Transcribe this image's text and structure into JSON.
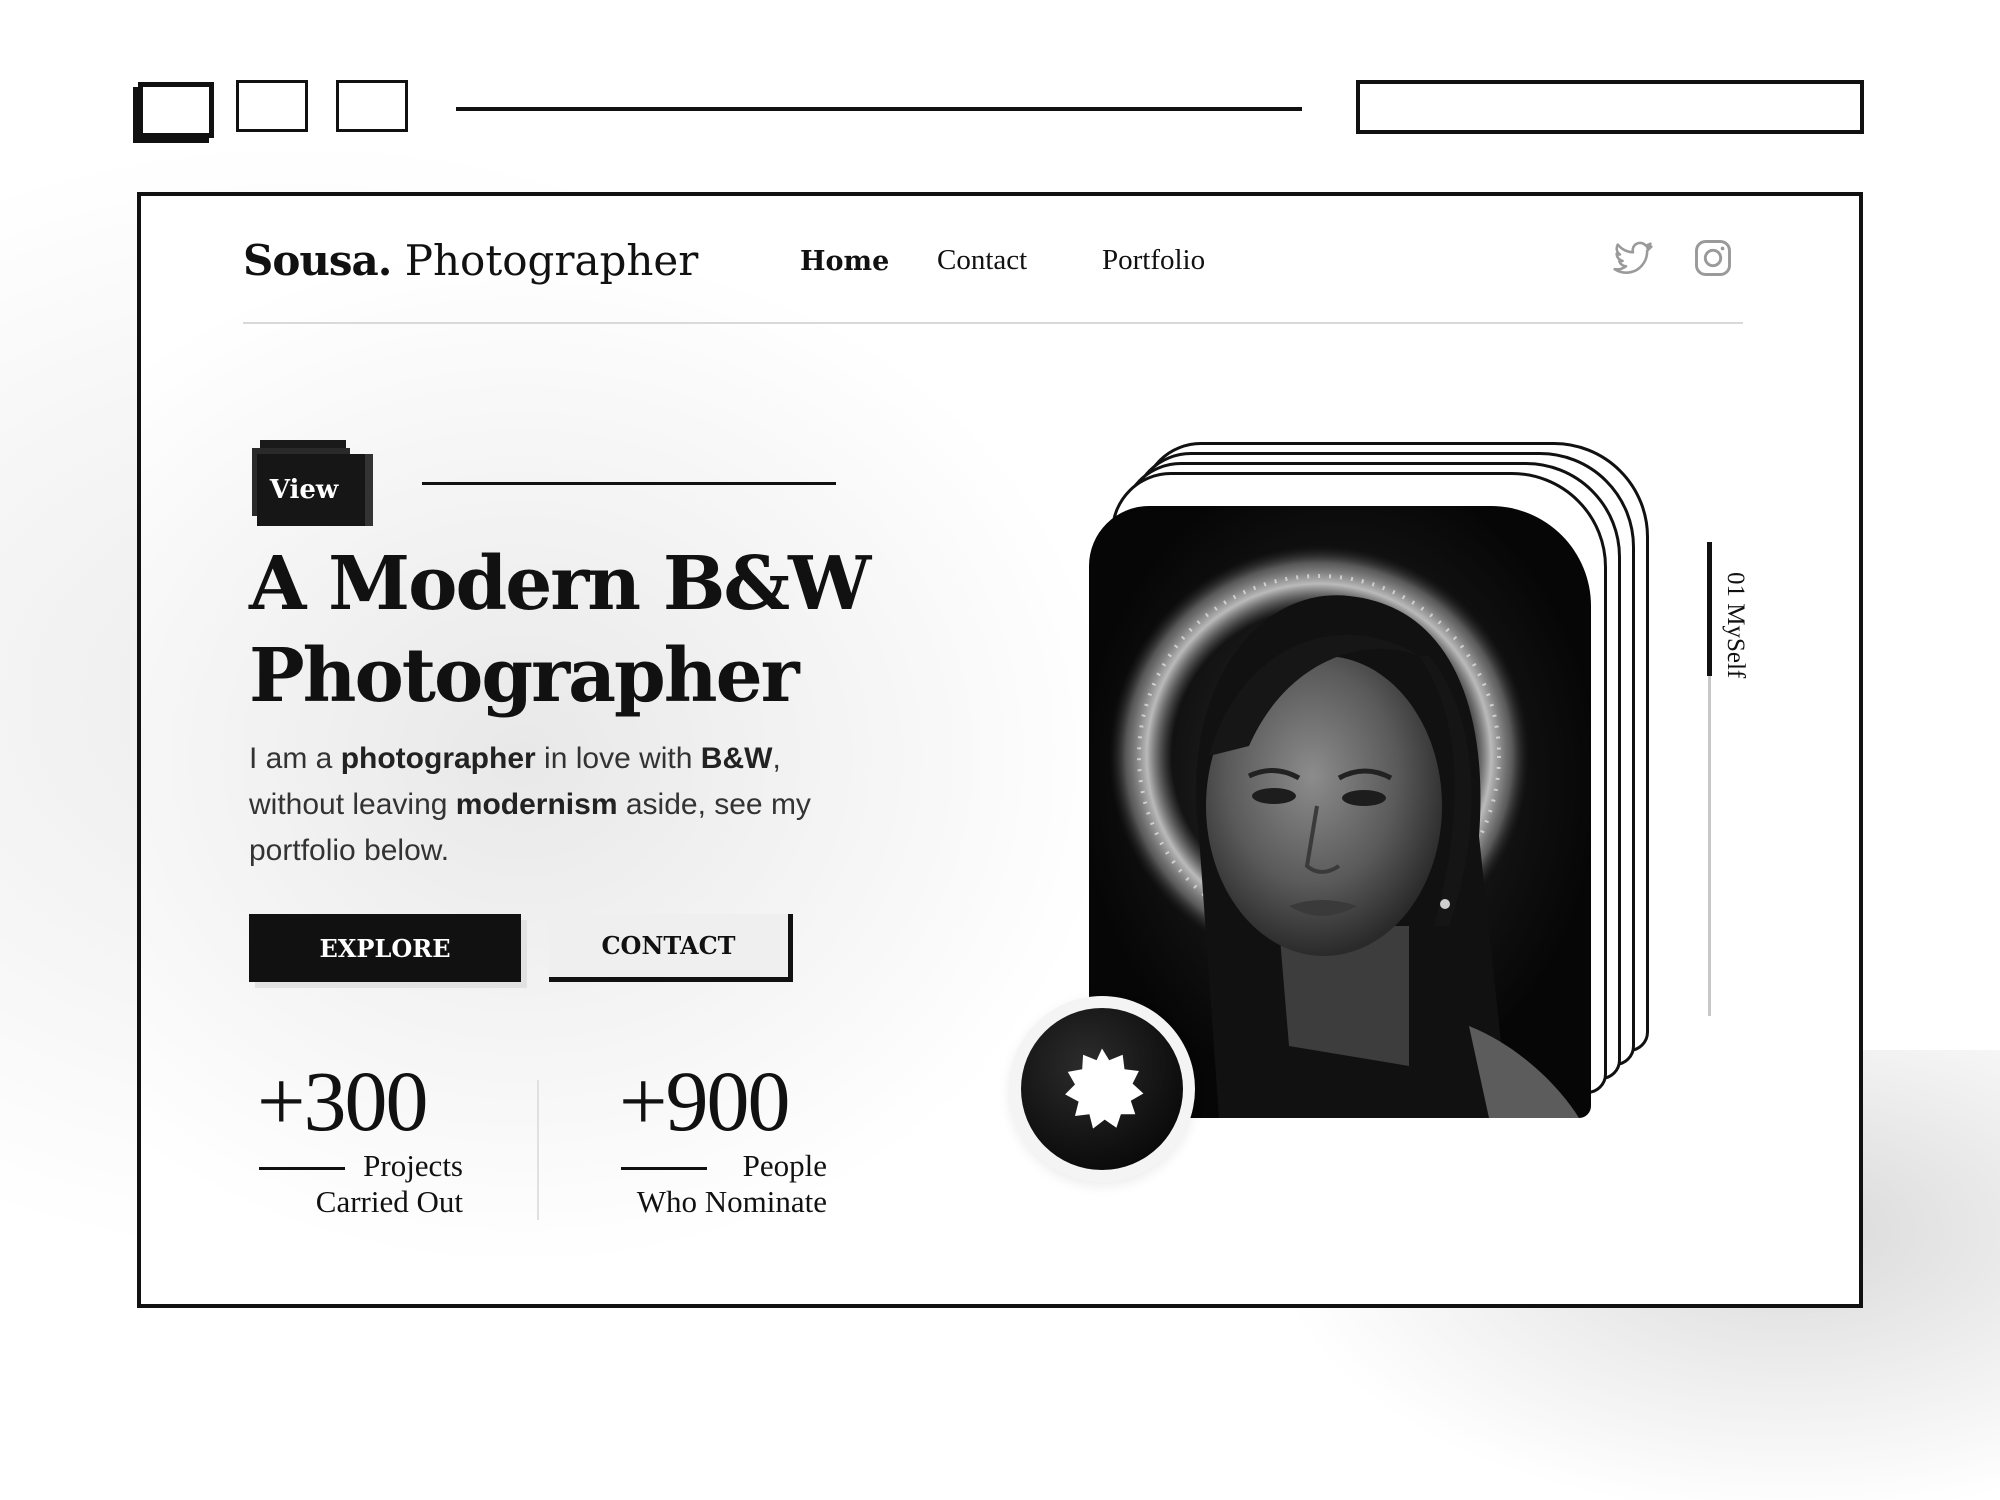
{
  "browser": {
    "window_buttons": [
      "window-control-1",
      "window-control-2",
      "window-control-3"
    ]
  },
  "header": {
    "logo_bold": "Sousa.",
    "logo_light": "Photographer",
    "nav": [
      {
        "label": "Home",
        "active": true
      },
      {
        "label": "Contact",
        "active": false
      },
      {
        "label": "Portfolio",
        "active": false
      }
    ],
    "social_icons": [
      "twitter-icon",
      "instagram-icon"
    ]
  },
  "hero": {
    "badge_label": "View",
    "title_line1": "A Modern B&W",
    "title_line2": "Photographer",
    "desc": {
      "p1": "I am a ",
      "b1": "photographer",
      "p2": " in love with ",
      "b2": "B&W",
      "p3": ",",
      "p4": "without leaving ",
      "b3": "modernism",
      "p5": " aside, see my",
      "p6": "portfolio below."
    },
    "explore_label": "EXPLORE",
    "contact_label": "CONTACT"
  },
  "stats": [
    {
      "value": "+300",
      "label_line1": "Projects",
      "label_line2": "Carried Out"
    },
    {
      "value": "+900",
      "label_line1": "People",
      "label_line2": "Who Nominate"
    }
  ],
  "side": {
    "label": "01 MySelf"
  },
  "colors": {
    "primary": "#111111",
    "background": "#ffffff",
    "muted": "#d9d9d9"
  }
}
